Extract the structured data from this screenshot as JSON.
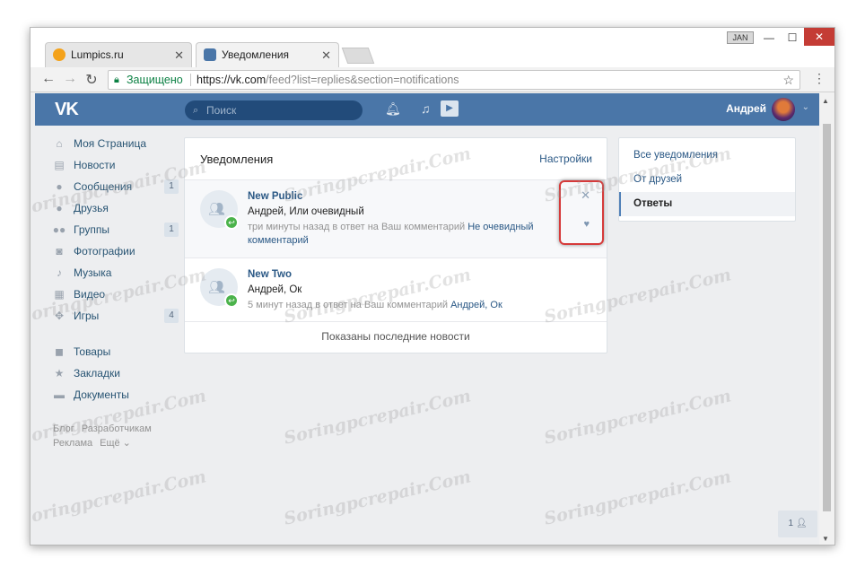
{
  "browser": {
    "tabs": [
      {
        "title": "Lumpics.ru",
        "favicon_color": "#f4a21a"
      },
      {
        "title": "Уведомления",
        "favicon_color": "#4a76a8"
      }
    ],
    "window_user": "JAN",
    "minimize": "—",
    "maximize": "☐",
    "close": "✕",
    "secure_label": "Защищено",
    "url_host": "https://vk.com",
    "url_path": "/feed?list=replies&section=notifications"
  },
  "vk": {
    "logo": "VK",
    "search_placeholder": "Поиск",
    "username": "Андрей",
    "accent": "#4a76a8"
  },
  "sidebar": {
    "items": [
      {
        "label": "Моя Страница",
        "icon": "home-icon",
        "badge": ""
      },
      {
        "label": "Новости",
        "icon": "news-icon",
        "badge": ""
      },
      {
        "label": "Сообщения",
        "icon": "message-icon",
        "badge": "1"
      },
      {
        "label": "Друзья",
        "icon": "friend-icon",
        "badge": ""
      },
      {
        "label": "Группы",
        "icon": "groups-icon",
        "badge": "1"
      },
      {
        "label": "Фотографии",
        "icon": "camera-icon",
        "badge": ""
      },
      {
        "label": "Музыка",
        "icon": "music-icon",
        "badge": ""
      },
      {
        "label": "Видео",
        "icon": "film-icon",
        "badge": ""
      },
      {
        "label": "Игры",
        "icon": "gamepad-icon",
        "badge": "4"
      }
    ],
    "extra": [
      {
        "label": "Товары",
        "icon": "bag-icon"
      },
      {
        "label": "Закладки",
        "icon": "star-icon"
      },
      {
        "label": "Документы",
        "icon": "document-icon"
      }
    ],
    "footer": [
      "Блог",
      "Разработчикам",
      "Реклама",
      "Ещё ⌄"
    ]
  },
  "notifications": {
    "title": "Уведомления",
    "settings": "Настройки",
    "items": [
      {
        "name": "New Public",
        "who": "Андрей, Или очевидный",
        "meta": "три минуты назад в ответ на Ваш комментарий",
        "link": "Не очевидный комментарий"
      },
      {
        "name": "New Two",
        "who": "Андрей, Ок",
        "meta": "5 минут назад в ответ на Ваш комментарий",
        "link": "Андрей, Ок"
      }
    ],
    "footer": "Показаны последние новости"
  },
  "right_menu": {
    "items": [
      "Все уведомления",
      "От друзей",
      "Ответы"
    ],
    "active": "Ответы"
  },
  "chat_count": "1",
  "watermark": "Soringpcrepair.Com"
}
